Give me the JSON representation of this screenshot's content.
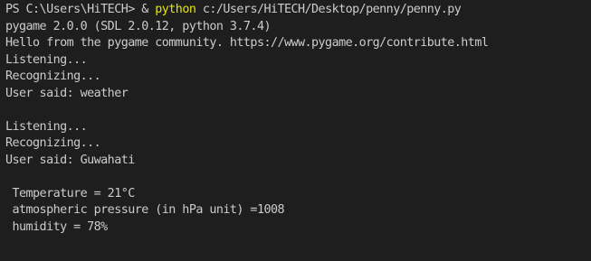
{
  "terminal": {
    "prompt_prefix": "PS C:\\Users\\HiTECH> & ",
    "command_keyword": "python",
    "command_args": " c:/Users/HiTECH/Desktop/penny/penny.py",
    "lines": [
      "pygame 2.0.0 (SDL 2.0.12, python 3.7.4)",
      "Hello from the pygame community. https://www.pygame.org/contribute.html",
      "Listening...",
      "Recognizing...",
      "User said: weather",
      "",
      "Listening...",
      "Recognizing...",
      "User said: Guwahati",
      "",
      " Temperature = 21°C",
      " atmospheric pressure (in hPa unit) =1008",
      " humidity = 78%"
    ]
  },
  "colors": {
    "background": "#1e1e1e",
    "text": "#cccccc",
    "command_highlight": "#e5e510"
  }
}
